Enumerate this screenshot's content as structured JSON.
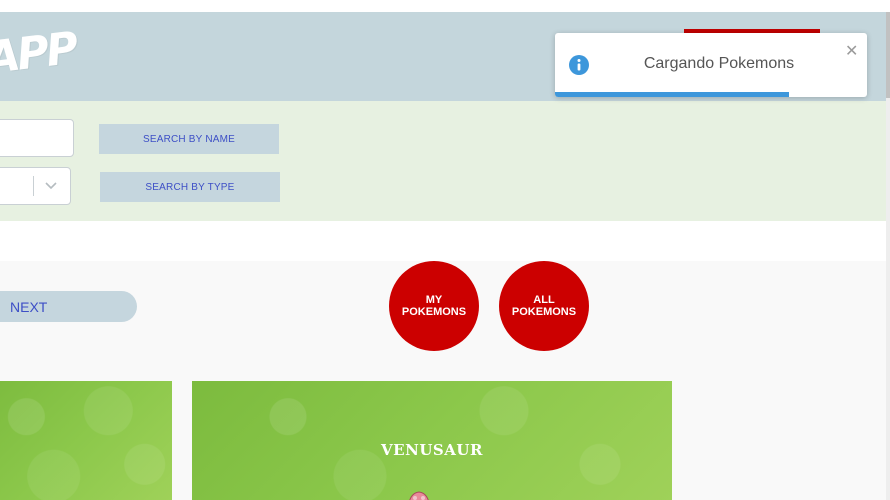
{
  "header": {
    "logo_text": "APP"
  },
  "search": {
    "name_button": "SEARCH BY NAME",
    "type_button": "SEARCH BY TYPE",
    "name_placeholder": ""
  },
  "nav": {
    "next_label": "NEXT",
    "my_pokemons_label": "MY\nPOKEMONS",
    "all_pokemons_label": "ALL\nPOKEMONS"
  },
  "cards": [
    {
      "name": ""
    },
    {
      "name": "VENUSAUR"
    }
  ],
  "toast": {
    "message": "Cargando Pokemons",
    "progress": 0.75,
    "icon": "info-icon"
  },
  "colors": {
    "header_bg": "#c4d6dc",
    "search_bg": "#e7f1e1",
    "accent_red": "#cc0000",
    "button_bg": "#c5d6de",
    "button_text": "#3d4fc6",
    "card_green": "#8cc84b",
    "toast_progress": "#3d97db"
  }
}
